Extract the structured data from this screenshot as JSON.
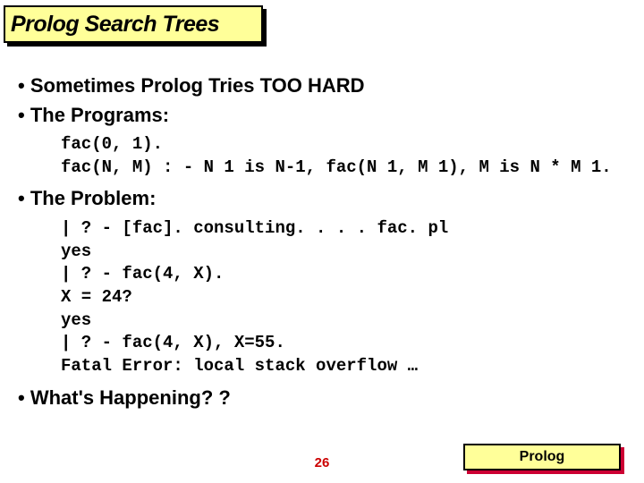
{
  "title": "Prolog Search Trees",
  "bullets": {
    "b1": "Sometimes Prolog Tries TOO HARD",
    "b2": "The Programs:",
    "b3": "The Problem:",
    "b4": "What's Happening? ?"
  },
  "code1": "fac(0, 1).\nfac(N, M) : - N 1 is N-1, fac(N 1, M 1), M is N * M 1.",
  "code2": "| ? - [fac]. consulting. . . . fac. pl\nyes\n| ? - fac(4, X).\nX = 24?\nyes\n| ? - fac(4, X), X=55.\nFatal Error: local stack overflow …",
  "footer": {
    "page": "26",
    "label": "Prolog"
  },
  "colors": {
    "title_bg": "#ffff99",
    "shadow": "#000000",
    "footer_shadow": "#cc0033",
    "page_num": "#cc0000"
  }
}
